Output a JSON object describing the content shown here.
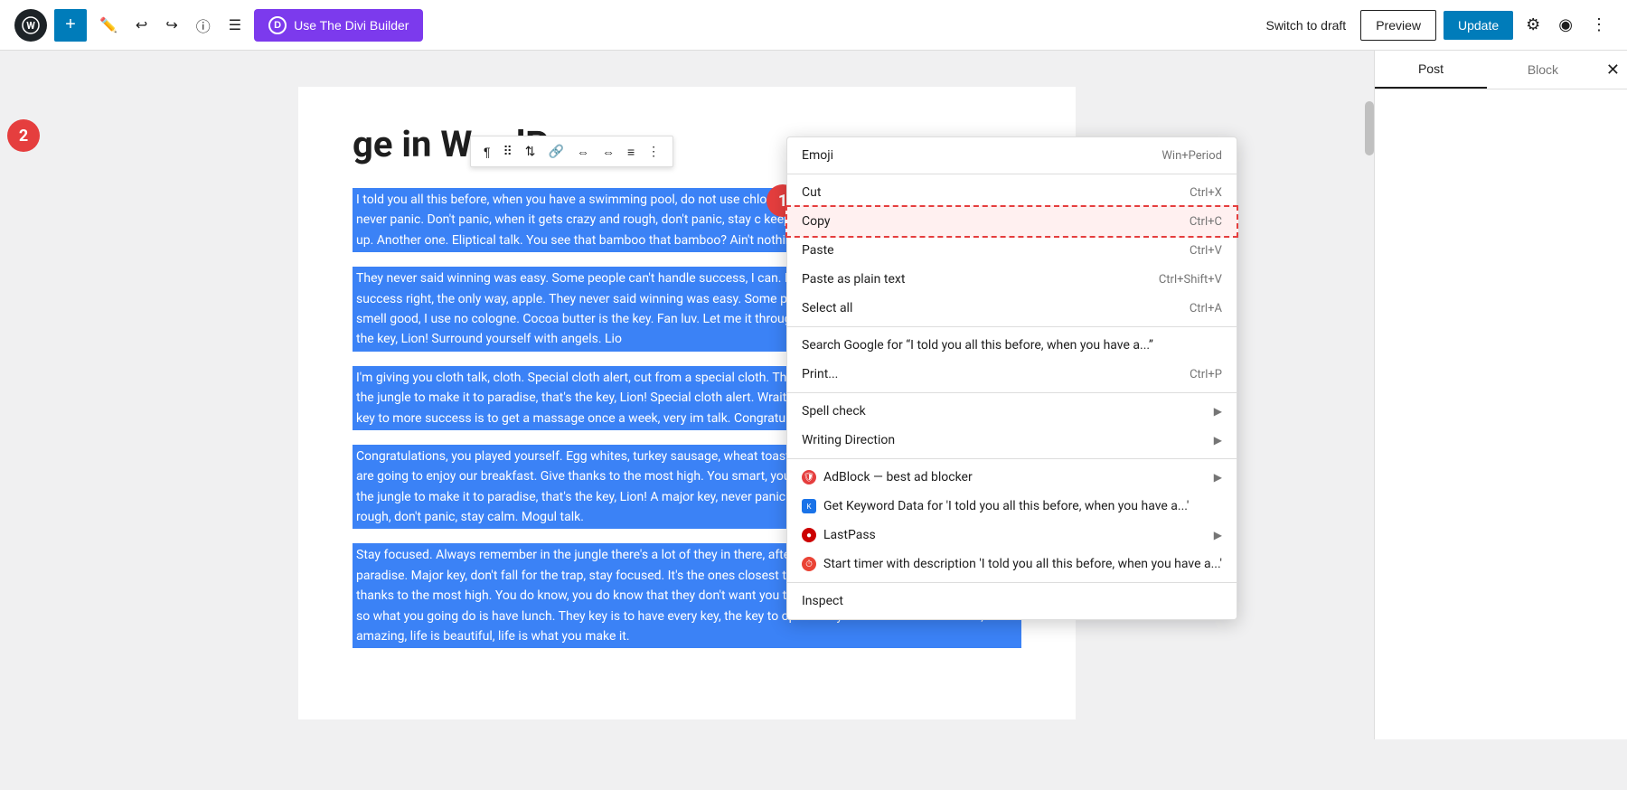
{
  "header": {
    "wp_logo_text": "W",
    "add_label": "+",
    "divi_button_label": "Use The Divi Builder",
    "divi_letter": "D",
    "switch_draft_label": "Switch to draft",
    "preview_label": "Preview",
    "update_label": "Update"
  },
  "post": {
    "title_partial": "ge in WordPress",
    "paragraphs": [
      "I told you all this before, when you have a swimming pool, do not use chlorine, use salt water, the healing. A major key, never panic. Don't panic, when it gets crazy and rough, don't panic, stay c keep your head above the water, never give up. Another one. Eliptical talk. You see that bamboo that bamboo? Ain't nothin' like bamboo. Bless up.",
      "They never said winning was easy. Some people can't handle success, I can. Don't ever play yourself. Celebrate success right, the only way, apple. They never said winning was easy. Some people can't ladies always say Khaled you smell good, I use no cologne. Cocoa butter is the key. Fan luv. Let me it through the jungle to make it to paradise, that's the key, Lion! Surround yourself with angels. Lio",
      "I'm giving you cloth talk, cloth. Special cloth alert, cut from a special cloth. They don't want us to wi to make it through the jungle to make it to paradise, that's the key, Lion! Special cloth alert. Wraith coconut, fresh coconut, trust me. The key to more success is to get a massage once a week, very im talk. Congratulations, you played yourself.",
      "Congratulations, you played yourself. Egg whites, turkey sausage, wheat toast, water. Of course the breakfast, so we are going to enjoy our breakfast. Give thanks to the most high. You smart, you loy clear, you have to make it through the jungle to make it to paradise, that's the key, Lion! A major key, never panic. Don't panic, when it gets crazy and rough, don't panic, stay calm. Mogul talk.",
      "Stay focused. Always remember in the jungle there's a lot of they in there, after you overcome they, you will make it to paradise. Major key, don't fall for the trap, stay focused. It's the ones closest to you that want to see you fail. Give thanks to the most high. You do know, you do know that they don't want you to have lunch. I'm keeping it real with you, so what you going do is have lunch. They key is to have every key, the key to open every door. Look at the sunset, life is amazing, life is beautiful, life is what you make it."
    ]
  },
  "context_menu": {
    "emoji_label": "Emoji",
    "emoji_shortcut": "Win+Period",
    "cut_label": "Cut",
    "cut_shortcut": "Ctrl+X",
    "copy_label": "Copy",
    "copy_shortcut": "Ctrl+C",
    "paste_label": "Paste",
    "paste_shortcut": "Ctrl+V",
    "paste_plain_label": "Paste as plain text",
    "paste_plain_shortcut": "Ctrl+Shift+V",
    "select_all_label": "Select all",
    "select_all_shortcut": "Ctrl+A",
    "search_google_label": "Search Google for “I told you all this before, when you have a...”",
    "print_label": "Print...",
    "print_shortcut": "Ctrl+P",
    "spell_check_label": "Spell check",
    "writing_direction_label": "Writing Direction",
    "adblock_label": "AdBlock — best ad blocker",
    "keyword_label": "Get Keyword Data for 'I told you all this before, when you have a...'",
    "lastpass_label": "LastPass",
    "timer_label": "Start timer with description 'I told you all this before, when you have a...'",
    "inspect_label": "Inspect"
  },
  "sidebar": {
    "post_tab": "Post",
    "block_tab": "Block"
  },
  "badges": {
    "badge1": "1",
    "badge2": "2"
  }
}
